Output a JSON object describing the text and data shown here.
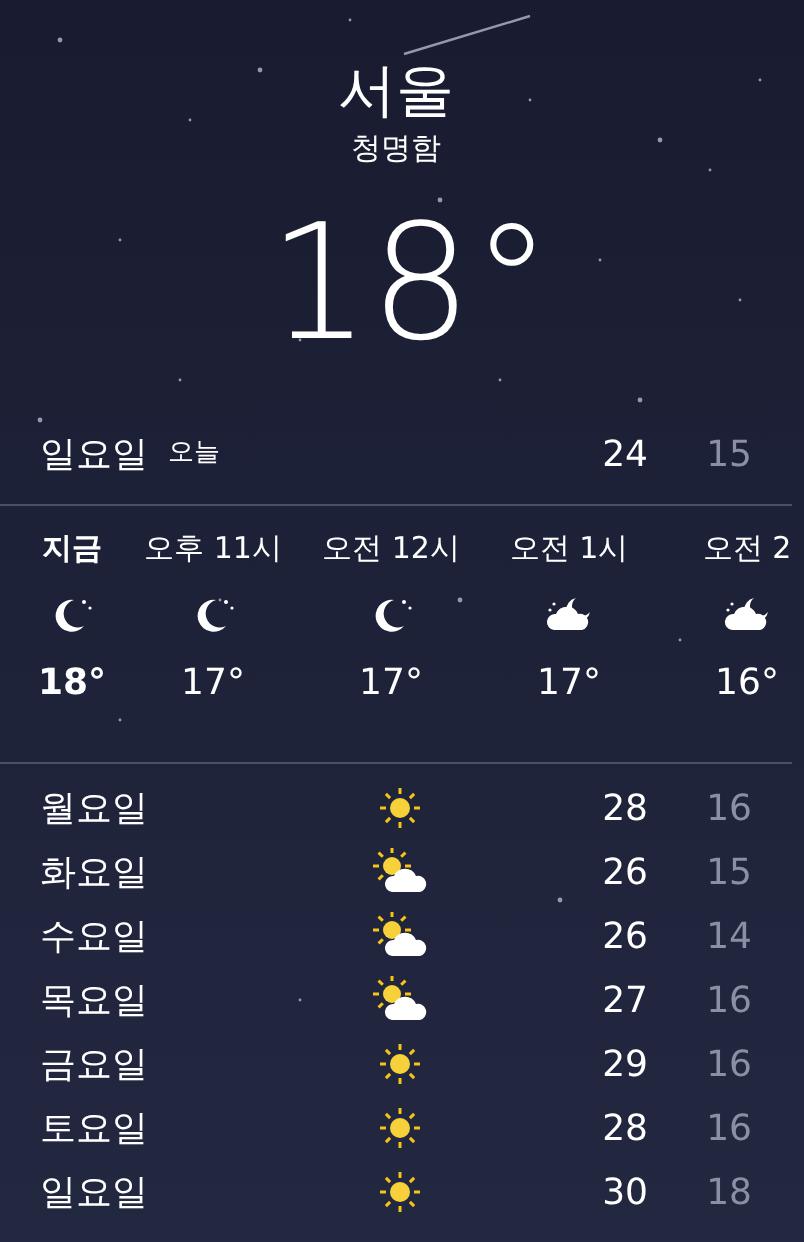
{
  "location": {
    "city": "서울",
    "condition": "청명함",
    "temperature": "18°"
  },
  "today": {
    "day": "일요일",
    "label": "오늘",
    "high": "24",
    "low": "15"
  },
  "hourly": [
    {
      "time": "지금",
      "kind": "moon",
      "temp": "18°",
      "current": true
    },
    {
      "time": "오후 11시",
      "kind": "moon",
      "temp": "17°",
      "current": false
    },
    {
      "time": "오전 12시",
      "kind": "moon",
      "temp": "17°",
      "current": false
    },
    {
      "time": "오전 1시",
      "kind": "cloudmoon",
      "temp": "17°",
      "current": false
    },
    {
      "time": "오전 2",
      "kind": "cloudmoon",
      "temp": "16°",
      "current": false
    }
  ],
  "daily": [
    {
      "day": "월요일",
      "kind": "sun",
      "high": "28",
      "low": "16"
    },
    {
      "day": "화요일",
      "kind": "partly",
      "high": "26",
      "low": "15"
    },
    {
      "day": "수요일",
      "kind": "partly",
      "high": "26",
      "low": "14"
    },
    {
      "day": "목요일",
      "kind": "partly",
      "high": "27",
      "low": "16"
    },
    {
      "day": "금요일",
      "kind": "sun",
      "high": "29",
      "low": "16"
    },
    {
      "day": "토요일",
      "kind": "sun",
      "high": "28",
      "low": "16"
    },
    {
      "day": "일요일",
      "kind": "sun",
      "high": "30",
      "low": "18"
    }
  ]
}
